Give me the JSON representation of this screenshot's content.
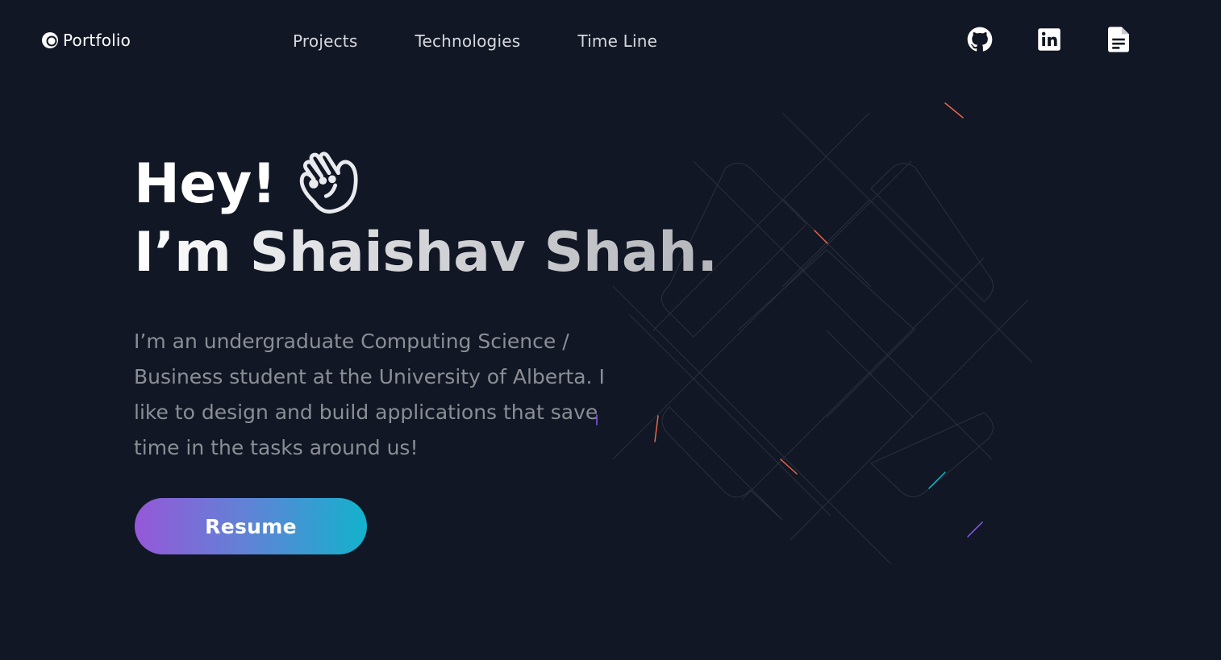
{
  "nav": {
    "logo": {
      "label": "Portfolio",
      "icon": "portfolio-logo-icon"
    },
    "links": [
      {
        "label": "Projects"
      },
      {
        "label": "Technologies"
      },
      {
        "label": "Time Line"
      }
    ],
    "icons": [
      {
        "name": "github-icon"
      },
      {
        "name": "linkedin-icon"
      },
      {
        "name": "resume-document-icon"
      }
    ]
  },
  "hero": {
    "greeting": "Hey!",
    "greeting_icon": "waving-hand-icon",
    "name_line": "I’m Shaishav Shah.",
    "description": "I’m an undergraduate Computing Science / Business student at the University of Alberta. I like to design and build applications that save time in the tasks around us!",
    "button_label": "Resume"
  },
  "colors": {
    "background": "#111724",
    "button_gradient_start": "#9558d8",
    "button_gradient_end": "#13b2cc",
    "text_muted": "#8b8e95"
  }
}
